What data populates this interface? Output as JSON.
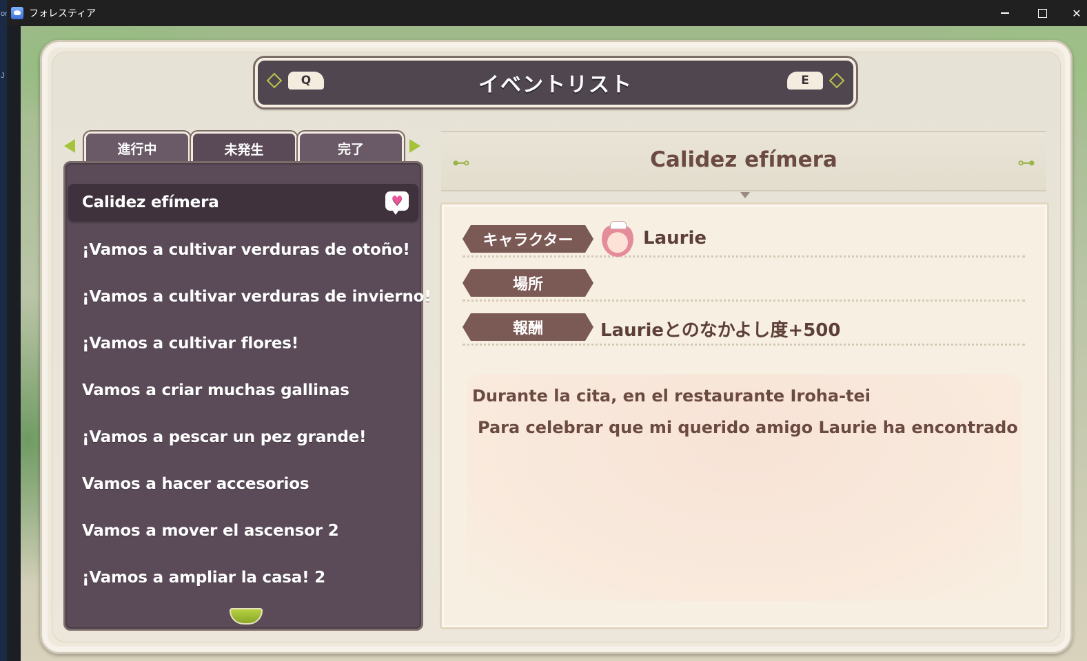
{
  "window": {
    "title": "フォレスティア",
    "side_letters": [
      "or",
      "J"
    ]
  },
  "header": {
    "title": "イベントリスト",
    "key_left": "Q",
    "key_right": "E"
  },
  "tabs": [
    {
      "label": "進行中"
    },
    {
      "label": "未発生",
      "selected": true
    },
    {
      "label": "完了"
    }
  ],
  "events": [
    {
      "label": "Calidez efímera",
      "selected": true
    },
    {
      "label": "¡Vamos a cultivar verduras de otoño!"
    },
    {
      "label": "¡Vamos a cultivar verduras de invierno!"
    },
    {
      "label": "¡Vamos a cultivar flores!"
    },
    {
      "label": "Vamos a criar muchas gallinas"
    },
    {
      "label": "¡Vamos a pescar un pez grande!"
    },
    {
      "label": "Vamos a hacer accesorios"
    },
    {
      "label": "Vamos a mover el ascensor 2"
    },
    {
      "label": "¡Vamos a ampliar la casa! 2"
    }
  ],
  "detail": {
    "title": "Calidez efímera",
    "character_label": "キャラクター",
    "character_name": "Laurie",
    "location_label": "場所",
    "location_value": "",
    "reward_label": "報酬",
    "reward_value": "Laurieとのなかよし度+500",
    "description_lines": [
      "Durante la cita, en el restaurante Iroha-tei",
      "Para celebrar que mi querido amigo Laurie ha encontrado pa"
    ]
  },
  "colors": {
    "panel": "#efe9dc",
    "list_bg": "#5b4b59",
    "accent_green": "#a6c23b",
    "title_brown": "#6b4a42",
    "label_brown": "#7b5a55"
  }
}
